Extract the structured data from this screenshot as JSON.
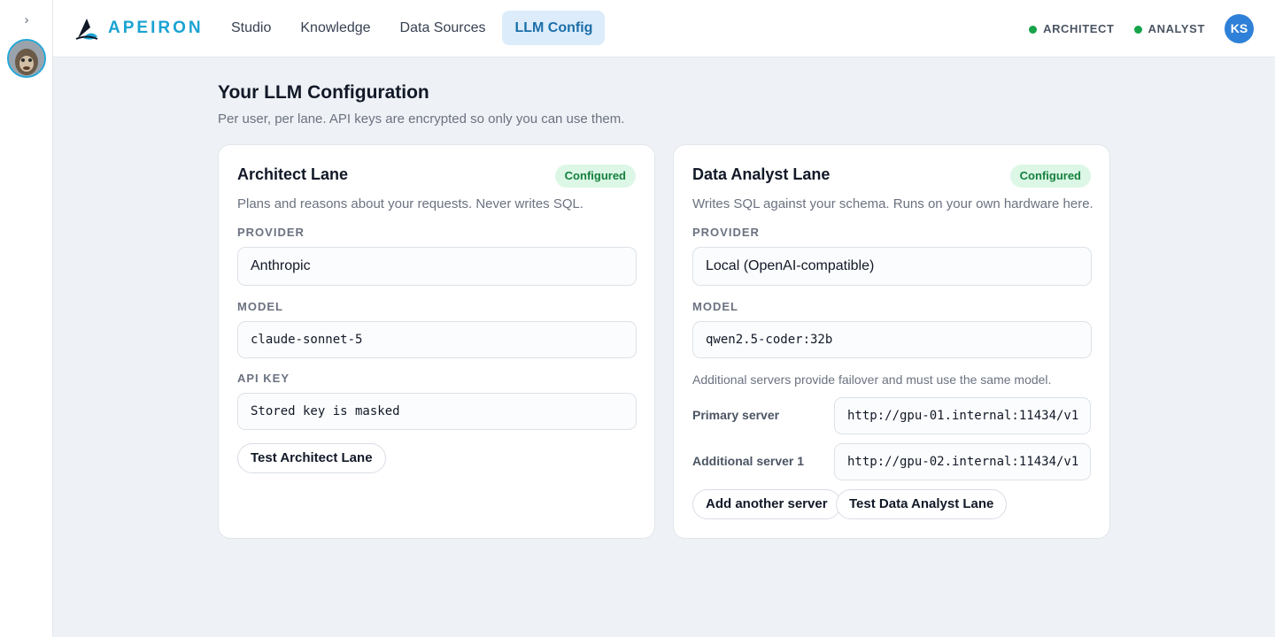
{
  "app": {
    "brand": "APEIRON",
    "brand_color": "#1aa3d3",
    "sidebar_toggle": "›",
    "nav": [
      {
        "label": "Studio",
        "active": false
      },
      {
        "label": "Knowledge",
        "active": false
      },
      {
        "label": "Data Sources",
        "active": false
      },
      {
        "label": "LLM Config",
        "active": true
      }
    ],
    "lane_indicators": [
      {
        "label": "ARCHITECT",
        "status_color": "#16a34a"
      },
      {
        "label": "ANALYST",
        "status_color": "#16a34a"
      }
    ],
    "user_initials": "KS"
  },
  "page": {
    "title": "Your LLM Configuration",
    "subtitle": "Per user, per lane. API keys are encrypted so only you can use them."
  },
  "architect": {
    "title": "Architect Lane",
    "status": "Configured",
    "description": "Plans and reasons about your requests. Never writes SQL.",
    "provider_label": "PROVIDER",
    "provider": "Anthropic",
    "model_label": "MODEL",
    "model": "claude-sonnet-5",
    "api_key_label": "API KEY",
    "api_key_placeholder": "Stored key is masked",
    "test_button": "Test Architect Lane"
  },
  "analyst": {
    "title": "Data Analyst Lane",
    "status": "Configured",
    "description": "Writes SQL against your schema. Runs on your own hardware here.",
    "provider_label": "PROVIDER",
    "provider": "Local (OpenAI-compatible)",
    "model_label": "MODEL",
    "model": "qwen2.5-coder:32b",
    "servers_note": "Additional servers provide failover and must use the same model.",
    "servers": [
      {
        "label": "Primary server",
        "url": "http://gpu-01.internal:11434/v1"
      },
      {
        "label": "Additional server 1",
        "url": "http://gpu-02.internal:11434/v1"
      }
    ],
    "add_server_button": "Add another server",
    "test_button": "Test Data Analyst Lane"
  }
}
